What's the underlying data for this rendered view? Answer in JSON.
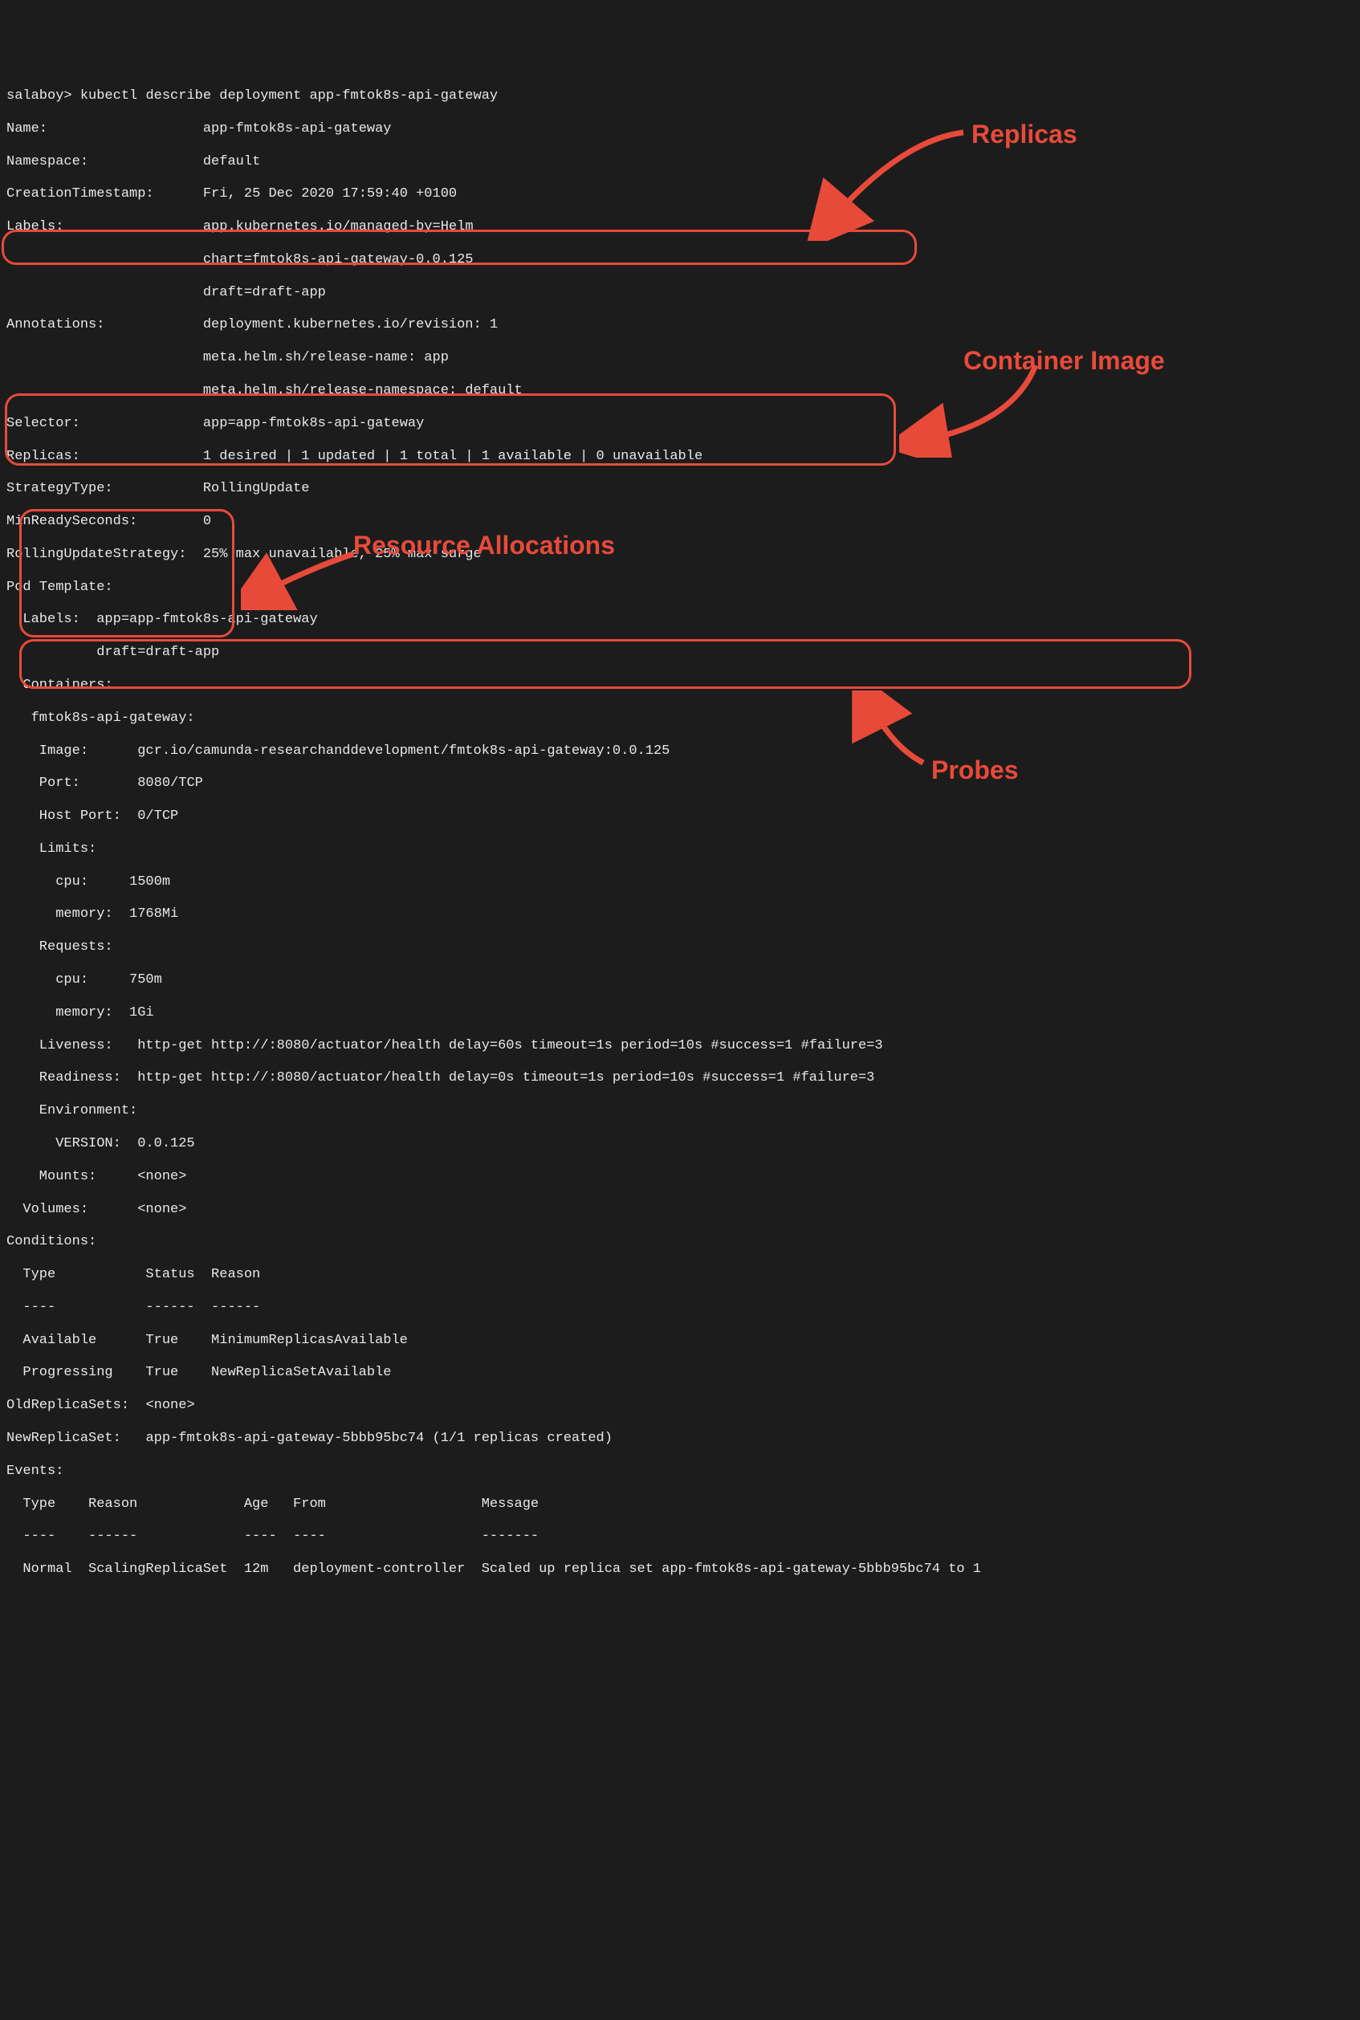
{
  "prompt": "salaboy> ",
  "command": "kubectl describe deployment app-fmtok8s-api-gateway",
  "fields": {
    "name_label": "Name:",
    "name_value": "app-fmtok8s-api-gateway",
    "namespace_label": "Namespace:",
    "namespace_value": "default",
    "creation_label": "CreationTimestamp:",
    "creation_value": "Fri, 25 Dec 2020 17:59:40 +0100",
    "labels_label": "Labels:",
    "labels_line1": "app.kubernetes.io/managed-by=Helm",
    "labels_line2": "chart=fmtok8s-api-gateway-0.0.125",
    "labels_line3": "draft=draft-app",
    "annotations_label": "Annotations:",
    "annotations_line1": "deployment.kubernetes.io/revision: 1",
    "annotations_line2": "meta.helm.sh/release-name: app",
    "annotations_line3": "meta.helm.sh/release-namespace: default",
    "selector_label": "Selector:",
    "selector_value": "app=app-fmtok8s-api-gateway",
    "replicas_label": "Replicas:",
    "replicas_value": "1 desired | 1 updated | 1 total | 1 available | 0 unavailable",
    "strategy_label": "StrategyType:",
    "strategy_value": "RollingUpdate",
    "minready_label": "MinReadySeconds:",
    "minready_value": "0",
    "rolling_label": "RollingUpdateStrategy:",
    "rolling_value": "25% max unavailable, 25% max surge",
    "podtemplate_label": "Pod Template:",
    "pod_labels_label": "  Labels:  ",
    "pod_labels_line1": "app=app-fmtok8s-api-gateway",
    "pod_labels_line2": "           draft=draft-app",
    "containers_label": "  Containers:",
    "container_name": "   fmtok8s-api-gateway:",
    "image_label": "    Image:      ",
    "image_value": "gcr.io/camunda-researchanddevelopment/fmtok8s-api-gateway:0.0.125",
    "port_label": "    Port:       ",
    "port_value": "8080/TCP",
    "hostport_label": "    Host Port:  ",
    "hostport_value": "0/TCP",
    "limits_label": "    Limits:",
    "limits_cpu": "      cpu:     1500m",
    "limits_mem": "      memory:  1768Mi",
    "requests_label": "    Requests:",
    "requests_cpu": "      cpu:     750m",
    "requests_mem": "      memory:  1Gi",
    "liveness_label": "    Liveness:   ",
    "liveness_value": "http-get http://:8080/actuator/health delay=60s timeout=1s period=10s #success=1 #failure=3",
    "readiness_label": "    Readiness:  ",
    "readiness_value": "http-get http://:8080/actuator/health delay=0s timeout=1s period=10s #success=1 #failure=3",
    "env_label": "    Environment:",
    "env_version": "      VERSION:  0.0.125",
    "mounts_label": "    Mounts:     ",
    "mounts_value": "<none>",
    "volumes_label": "  Volumes:      ",
    "volumes_value": "<none>",
    "conditions_label": "Conditions:",
    "conditions_header": "  Type           Status  Reason",
    "conditions_divider": "  ----           ------  ------",
    "condition_available": "  Available      True    MinimumReplicasAvailable",
    "condition_progressing": "  Progressing    True    NewReplicaSetAvailable",
    "oldrs_label": "OldReplicaSets:  ",
    "oldrs_value": "<none>",
    "newrs_label": "NewReplicaSet:   ",
    "newrs_value": "app-fmtok8s-api-gateway-5bbb95bc74 (1/1 replicas created)",
    "events_label": "Events:",
    "events_header": "  Type    Reason             Age   From                   Message",
    "events_divider": "  ----    ------             ----  ----                   -------",
    "events_row": "  Normal  ScalingReplicaSet  12m   deployment-controller  Scaled up replica set app-fmtok8s-api-gateway-5bbb95bc74 to 1"
  },
  "labels": {
    "replicas": "Replicas",
    "container_image": "Container Image",
    "resource_allocations": "Resource Allocations",
    "probes": "Probes"
  }
}
